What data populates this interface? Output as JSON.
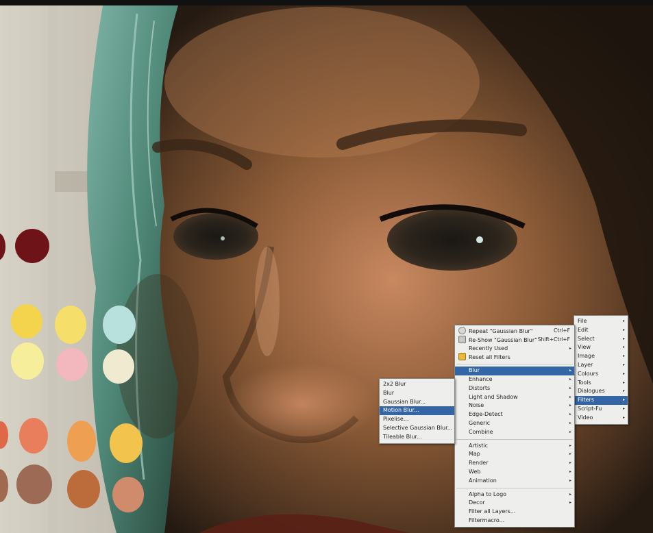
{
  "menubar_menu": {
    "items": [
      {
        "label": "File",
        "submenu": true
      },
      {
        "label": "Edit",
        "submenu": true
      },
      {
        "label": "Select",
        "submenu": true
      },
      {
        "label": "View",
        "submenu": true
      },
      {
        "label": "Image",
        "submenu": true
      },
      {
        "label": "Layer",
        "submenu": true
      },
      {
        "label": "Colours",
        "submenu": true
      },
      {
        "label": "Tools",
        "submenu": true
      },
      {
        "label": "Dialogues",
        "submenu": true
      },
      {
        "label": "Filters",
        "submenu": true,
        "selected": true
      },
      {
        "label": "Script-Fu",
        "submenu": true
      },
      {
        "label": "Video",
        "submenu": true
      }
    ]
  },
  "filters_menu": {
    "repeat": {
      "label": "Repeat \"Gaussian Blur\"",
      "accel": "Ctrl+F",
      "icon": "repeat-icon"
    },
    "reshow": {
      "label": "Re-Show \"Gaussian Blur\"",
      "accel": "Shift+Ctrl+F",
      "icon": "reshow-icon"
    },
    "recently_used": {
      "label": "Recently Used"
    },
    "reset_all": {
      "label": "Reset all Filters",
      "icon": "reset-filters-icon"
    },
    "group1": [
      {
        "label": "Blur",
        "selected": true
      },
      {
        "label": "Enhance"
      },
      {
        "label": "Distorts"
      },
      {
        "label": "Light and Shadow"
      },
      {
        "label": "Noise"
      },
      {
        "label": "Edge-Detect"
      },
      {
        "label": "Generic"
      },
      {
        "label": "Combine"
      }
    ],
    "group2": [
      {
        "label": "Artistic"
      },
      {
        "label": "Map"
      },
      {
        "label": "Render"
      },
      {
        "label": "Web"
      },
      {
        "label": "Animation"
      }
    ],
    "group3": [
      {
        "label": "Alpha to Logo",
        "submenu": true
      },
      {
        "label": "Decor",
        "submenu": true
      },
      {
        "label": "Filter all Layers...",
        "submenu": false
      },
      {
        "label": "Filtermacro...",
        "submenu": false
      }
    ]
  },
  "blur_menu": {
    "items": [
      {
        "label": "2x2 Blur"
      },
      {
        "label": "Blur"
      },
      {
        "label": "Gaussian Blur..."
      },
      {
        "label": "Motion Blur...",
        "selected": true
      },
      {
        "label": "Pixelise..."
      },
      {
        "label": "Selective Gaussian Blur..."
      },
      {
        "label": "Tileable Blur..."
      }
    ]
  },
  "palette": {
    "colors": [
      "#6e1418",
      "#f4d44c",
      "#f5de6a",
      "#b8e0dc",
      "#f7ee9c",
      "#f3b8bd",
      "#f0ebd0",
      "#e87e5c",
      "#ee9f52",
      "#f2c44e",
      "#9c6a55",
      "#bc6c3a",
      "#d08a6c"
    ]
  },
  "colors": {
    "menu_bg": "#eeeeec",
    "highlight": "#3465a4",
    "canvas_bg": "#0e0d0c"
  }
}
